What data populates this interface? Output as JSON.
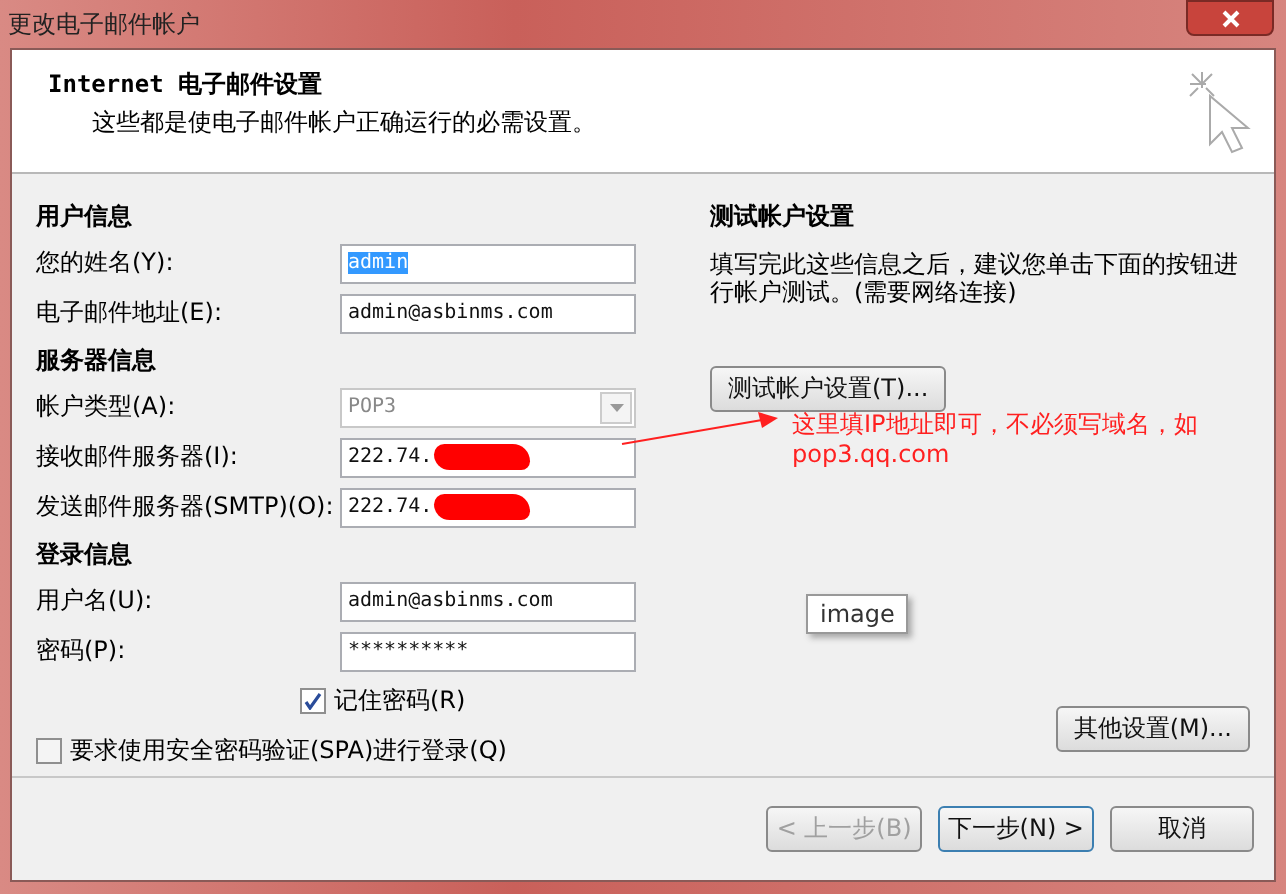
{
  "window": {
    "title": "更改电子邮件帐户"
  },
  "header": {
    "title": "Internet 电子邮件设置",
    "subtitle": "这些都是使电子邮件帐户正确运行的必需设置。"
  },
  "sections": [
    {
      "heading": "用户信息",
      "fields": [
        {
          "label": "您的姓名(Y):",
          "value": "admin",
          "kind": "text",
          "selected": true,
          "disabled": false,
          "redacted": false
        },
        {
          "label": "电子邮件地址(E):",
          "value": "admin@asbinms.com",
          "kind": "text",
          "selected": false,
          "disabled": false,
          "redacted": false
        }
      ]
    },
    {
      "heading": "服务器信息",
      "fields": [
        {
          "label": "帐户类型(A):",
          "value": "POP3",
          "kind": "dropdown",
          "selected": false,
          "disabled": true,
          "redacted": false
        },
        {
          "label": "接收邮件服务器(I):",
          "value": "222.74.",
          "kind": "text",
          "selected": false,
          "disabled": false,
          "redacted": true
        },
        {
          "label": "发送邮件服务器(SMTP)(O):",
          "value": "222.74.",
          "kind": "text",
          "selected": false,
          "disabled": false,
          "redacted": true
        }
      ]
    },
    {
      "heading": "登录信息",
      "fields": [
        {
          "label": "用户名(U):",
          "value": "admin@asbinms.com",
          "kind": "text",
          "selected": false,
          "disabled": false,
          "redacted": false
        },
        {
          "label": "密码(P):",
          "value": "**********",
          "kind": "text",
          "selected": false,
          "disabled": false,
          "redacted": false
        }
      ]
    }
  ],
  "remember_password": {
    "label": "记住密码(R)",
    "checked": true
  },
  "spa": {
    "label": "要求使用安全密码验证(SPA)进行登录(Q)",
    "checked": false
  },
  "test": {
    "heading": "测试帐户设置",
    "description": "填写完此这些信息之后，建议您单击下面的按钮进行帐户测试。(需要网络连接)",
    "button": "测试帐户设置(T)..."
  },
  "annotation": "这里填IP地址即可，不必须写域名，如pop3.qq.com",
  "tooltip": "image",
  "more_settings": "其他设置(M)...",
  "footer": [
    {
      "label": "< 上一步(B)",
      "disabled": true,
      "default": false
    },
    {
      "label": "下一步(N) >",
      "disabled": false,
      "default": true
    },
    {
      "label": "取消",
      "disabled": false,
      "default": false
    }
  ]
}
